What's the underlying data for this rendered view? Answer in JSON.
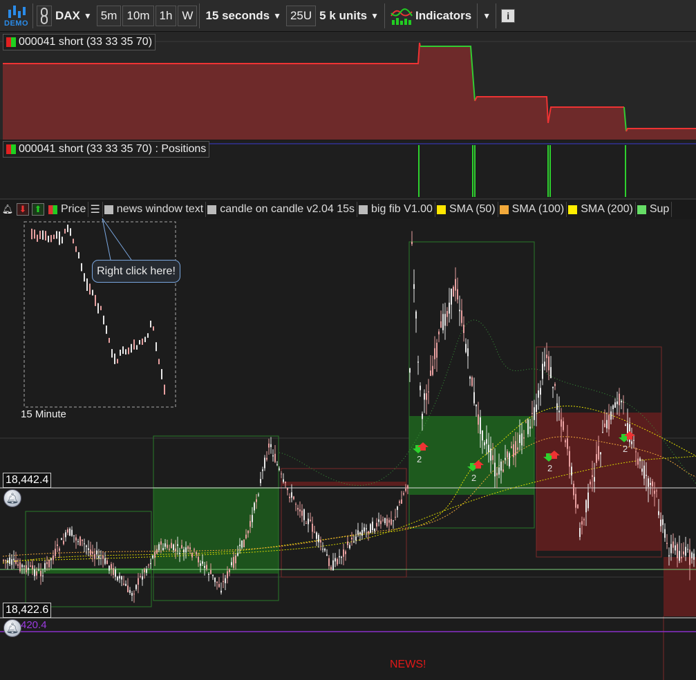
{
  "toolbar": {
    "demo_label": "DEMO",
    "symbol": "DAX",
    "timeframes": [
      "5m",
      "10m",
      "1h",
      "W"
    ],
    "interval": "15 seconds",
    "units_short": "25U",
    "units": "5 k units",
    "indicators_label": "Indicators",
    "info_label": "i"
  },
  "panes": {
    "equity_label": "000041 short (33 33 35 70)",
    "positions_label": "000041 short (33 33 35 70) : Positions"
  },
  "legend": {
    "items": [
      {
        "label": "Price",
        "color": "#d33",
        "color2": "#2c2"
      },
      {
        "label": "news window text",
        "color": "#bbbbbb"
      },
      {
        "label": "candle on candle v2.04 15s",
        "color": "#bbbbbb"
      },
      {
        "label": "big fib V1.00",
        "color": "#bbbbbb"
      },
      {
        "label": "SMA (50)",
        "color": "#ffe600"
      },
      {
        "label": "SMA (100)",
        "color": "#f2a93b"
      },
      {
        "label": "SMA (200)",
        "color": "#ffee00"
      },
      {
        "label": "Sup",
        "color": "#66dd66"
      }
    ]
  },
  "chart": {
    "inset_label": "15 Minute",
    "callout": "Right click here!",
    "price_high": "18,442.4",
    "price_low": "18,422.6",
    "price_purple": "420.4",
    "news": "NEWS!",
    "arrow_counts": [
      "2",
      "2",
      "2",
      "2"
    ],
    "colors": {
      "up_candle": "#e8e8e8",
      "down_candle": "#e8a0a0",
      "green_zone": "#1e6b1e",
      "red_zone": "#6b1e1e"
    }
  }
}
